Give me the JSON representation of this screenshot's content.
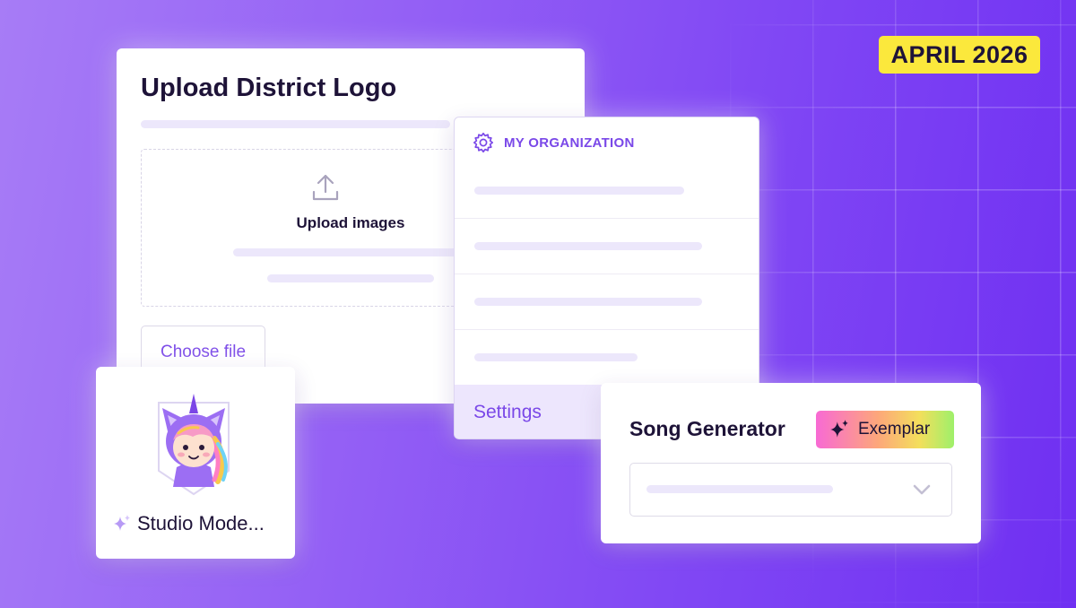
{
  "banner": {
    "date": "APRIL 2026"
  },
  "upload_card": {
    "title": "Upload District Logo",
    "dropzone_label": "Upload images",
    "choose_button": "Choose file"
  },
  "org_menu": {
    "title": "MY ORGANIZATION",
    "icon": "gear-icon",
    "settings_label": "Settings"
  },
  "studio_card": {
    "label": "Studio Mode...",
    "icon": "sparkle-icon",
    "mascot": "unicorn-mascot"
  },
  "song_card": {
    "title": "Song Generator",
    "badge": "Exemplar",
    "badge_icon": "sparkle-icon",
    "dropdown_icon": "chevron-down-icon"
  },
  "colors": {
    "accent": "#7a48e8",
    "badge_yellow": "#fbe83c",
    "text_dark": "#1e1338",
    "placeholder_bar": "#ece7fb"
  }
}
